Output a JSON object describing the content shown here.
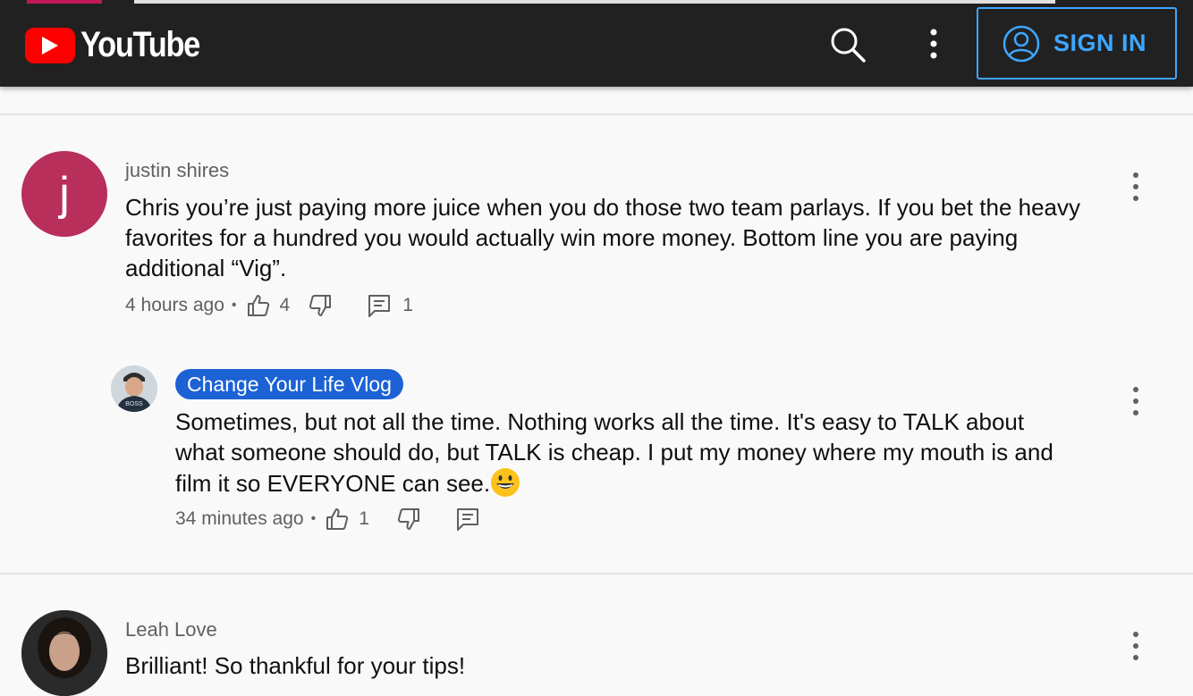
{
  "header": {
    "logo_text": "YouTube",
    "signin_label": "SIGN IN",
    "icons": [
      "youtube-play-icon",
      "search-icon",
      "more-vert-icon",
      "account-circle-icon"
    ]
  },
  "comments": [
    {
      "author": "justin shires",
      "avatar_letter": "j",
      "avatar_color": "#b82f5c",
      "text": "Chris you’re just paying more juice when you do those two team parlays. If you bet the heavy favorites for a hundred you would actually win more money. Bottom line you are paying additional “Vig”.",
      "time": "4 hours ago",
      "likes": "4",
      "replies": "1",
      "reply": {
        "author": "Change Your Life Vlog",
        "avatar_cap_text": "BOSS",
        "text": "Sometimes, but not all the time. Nothing works all the time. It's easy to TALK about what someone should do, but TALK is cheap. I put my money where my mouth is and film it so EVERYONE can see.",
        "time": "34 minutes ago",
        "likes": "1"
      }
    },
    {
      "author": "Leah Love",
      "text": "Brilliant! So thankful for your tips!"
    }
  ],
  "colors": {
    "accent": "#3ea6ff",
    "badge": "#1c62d5",
    "header_bg": "#212121",
    "logo_red": "#ff0000"
  }
}
